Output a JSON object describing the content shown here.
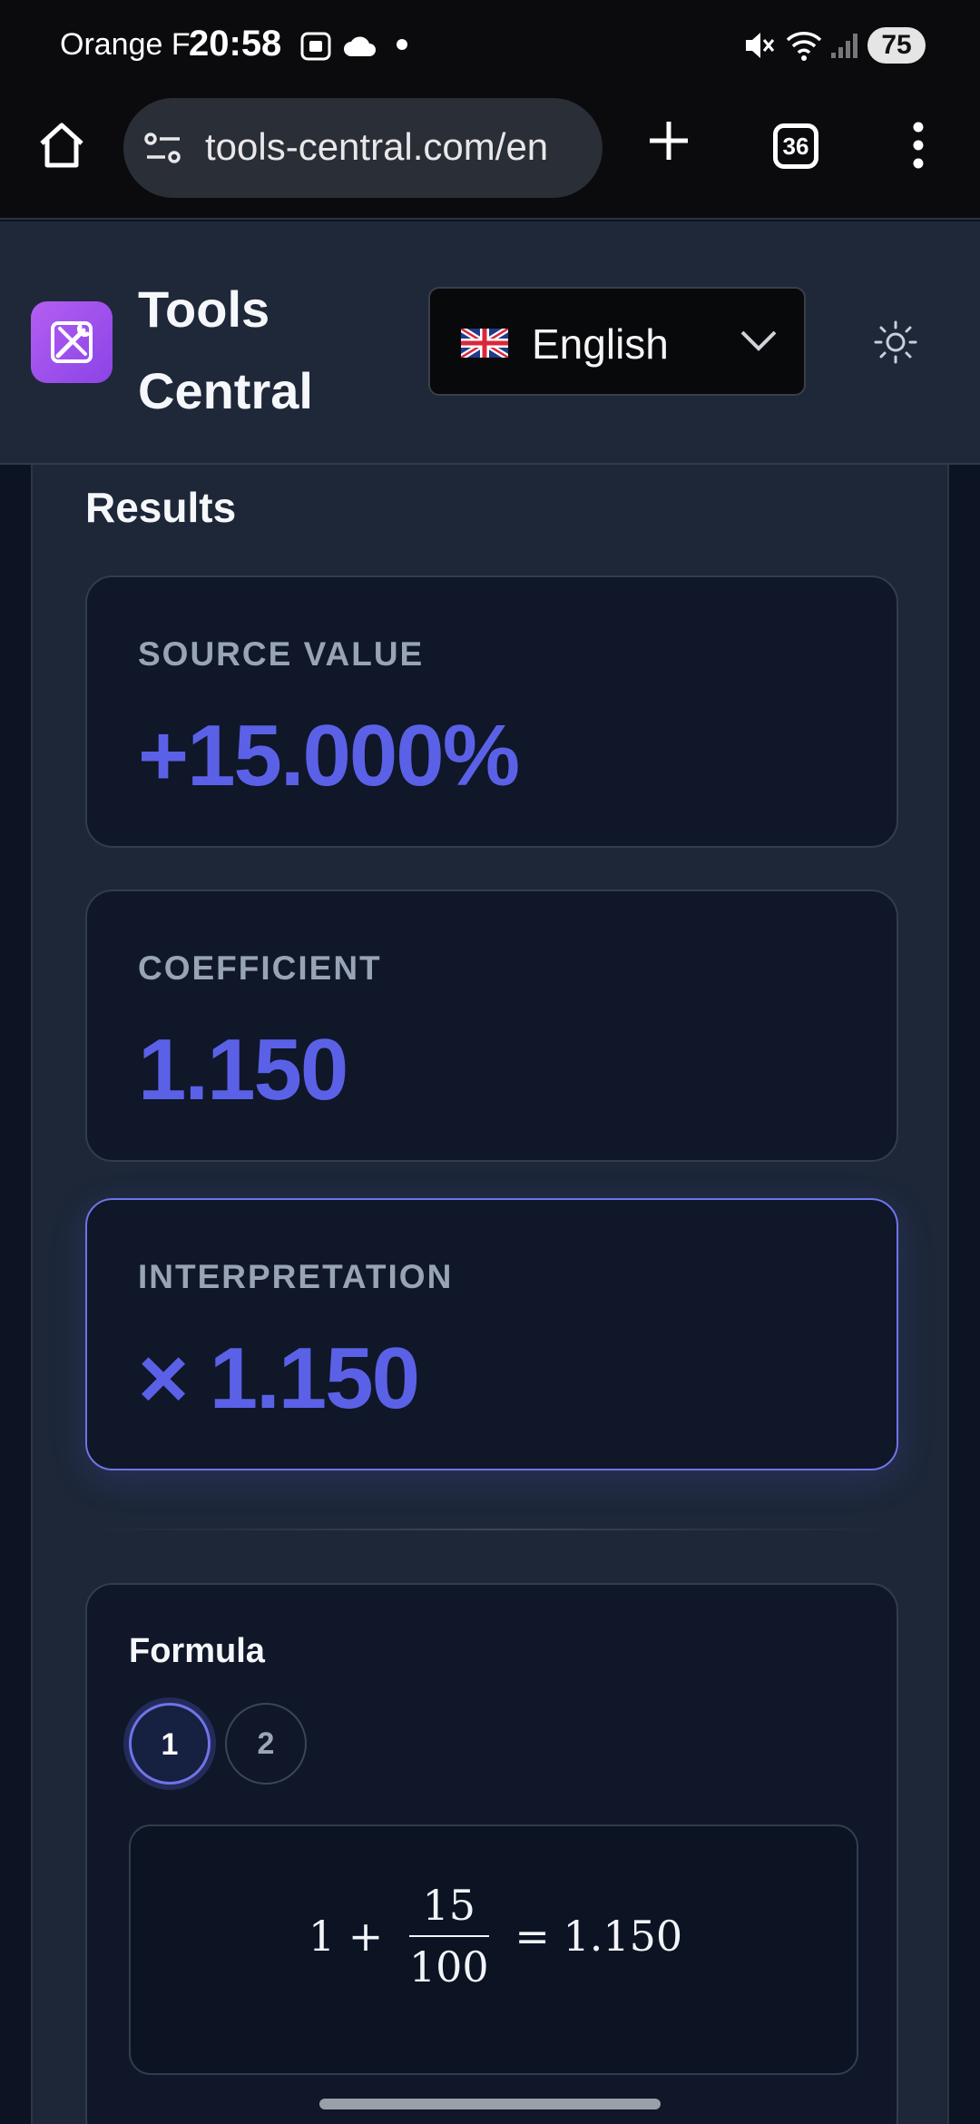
{
  "status_bar": {
    "carrier": "Orange F",
    "time": "20:58",
    "battery": "75"
  },
  "browser": {
    "url": "tools-central.com/en",
    "tab_count": "36"
  },
  "header": {
    "brand_line1": "Tools",
    "brand_line2": "Central",
    "language": "English"
  },
  "results": {
    "title": "Results",
    "cards": [
      {
        "label": "SOURCE VALUE",
        "value": "+15.000%"
      },
      {
        "label": "COEFFICIENT",
        "value": "1.150"
      },
      {
        "label": "INTERPRETATION",
        "value": "× 1.150"
      }
    ]
  },
  "formula": {
    "title": "Formula",
    "steps": [
      "1",
      "2"
    ],
    "lhs": "1 +",
    "numerator": "15",
    "denominator": "100",
    "rhs": "= 1.150"
  },
  "colors": {
    "accent": "#5b61e6",
    "panel": "#1d2738",
    "card": "#0f1729"
  }
}
